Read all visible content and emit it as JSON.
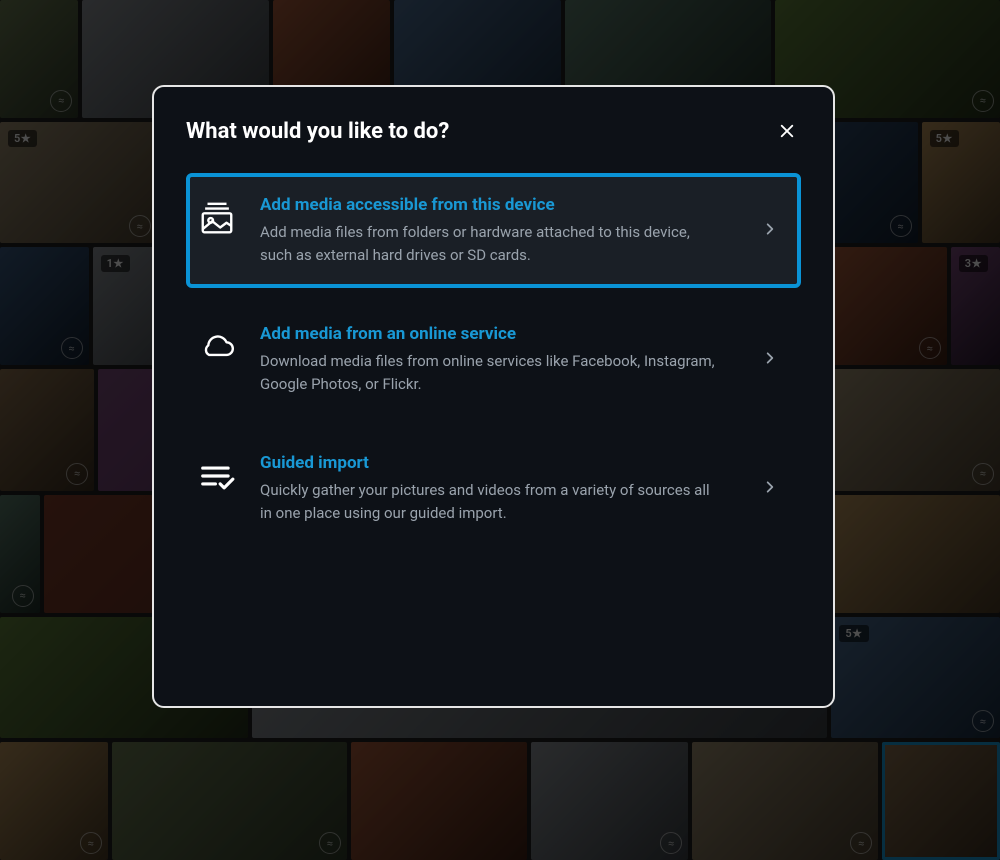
{
  "modal": {
    "title": "What would you like to do?",
    "options": [
      {
        "title": "Add media accessible from this device",
        "desc": "Add media files from folders or hardware attached to this device, such as external hard drives or SD cards.",
        "selected": true
      },
      {
        "title": "Add media from an online service",
        "desc": "Download media files from online services like Facebook, Instagram, Google Photos, or Flickr.",
        "selected": false
      },
      {
        "title": "Guided import",
        "desc": "Quickly gather your pictures and videos from a variety of sources all in one place using our guided import.",
        "selected": false
      }
    ]
  },
  "background": {
    "badges": {
      "five_star": "5★",
      "one_star": "1★",
      "three_star": "3★"
    }
  }
}
